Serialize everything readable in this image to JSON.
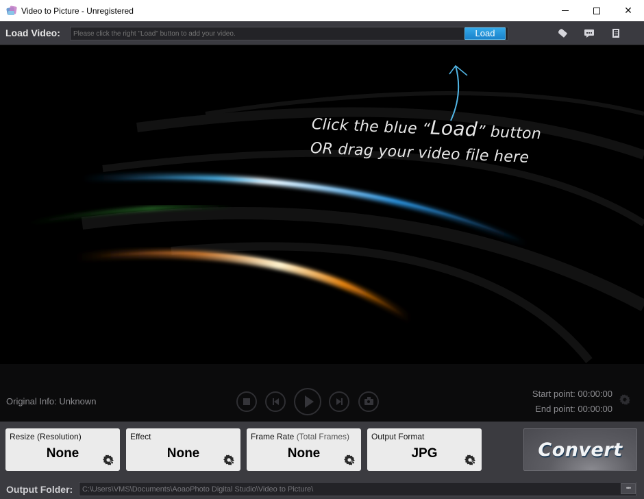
{
  "window": {
    "title": "Video to Picture - Unregistered",
    "controls": {
      "minimize": "minimize",
      "maximize": "maximize",
      "close": "✕"
    }
  },
  "load_bar": {
    "label": "Load Video:",
    "input_placeholder": "Please click the right \"Load\" button to add your video.",
    "input_value": "",
    "load_button": "Load",
    "icons": [
      "tag-icon",
      "chat-icon",
      "register-icon"
    ]
  },
  "video_area": {
    "hint_line1_pre": "Click the blue “",
    "hint_line1_big": "Load",
    "hint_line1_post": "” button",
    "hint_line2": "OR drag your video file here"
  },
  "playback": {
    "original_info": "Original Info: Unknown",
    "buttons": [
      "stop",
      "previous",
      "play",
      "next",
      "snapshot"
    ],
    "start_point": "Start point: 00:00:00",
    "end_point": "End point: 00:00:00"
  },
  "settings": {
    "cards": [
      {
        "title": "Resize (Resolution)",
        "title_sub": "",
        "value": "None"
      },
      {
        "title": "Effect",
        "title_sub": "",
        "value": "None"
      },
      {
        "title": "Frame Rate ",
        "title_sub": "(Total Frames)",
        "value": "None"
      },
      {
        "title": "Output Format",
        "title_sub": "",
        "value": "JPG"
      }
    ],
    "convert_button": "Convert"
  },
  "output": {
    "label": "Output Folder:",
    "path": "C:\\Users\\VMS\\Documents\\AoaoPhoto Digital Studio\\Video to Picture\\",
    "browse_button": "•••"
  },
  "colors": {
    "accent_blue": "#1e90d8",
    "panel_bg": "#3b3b40",
    "video_bg": "#000000"
  }
}
